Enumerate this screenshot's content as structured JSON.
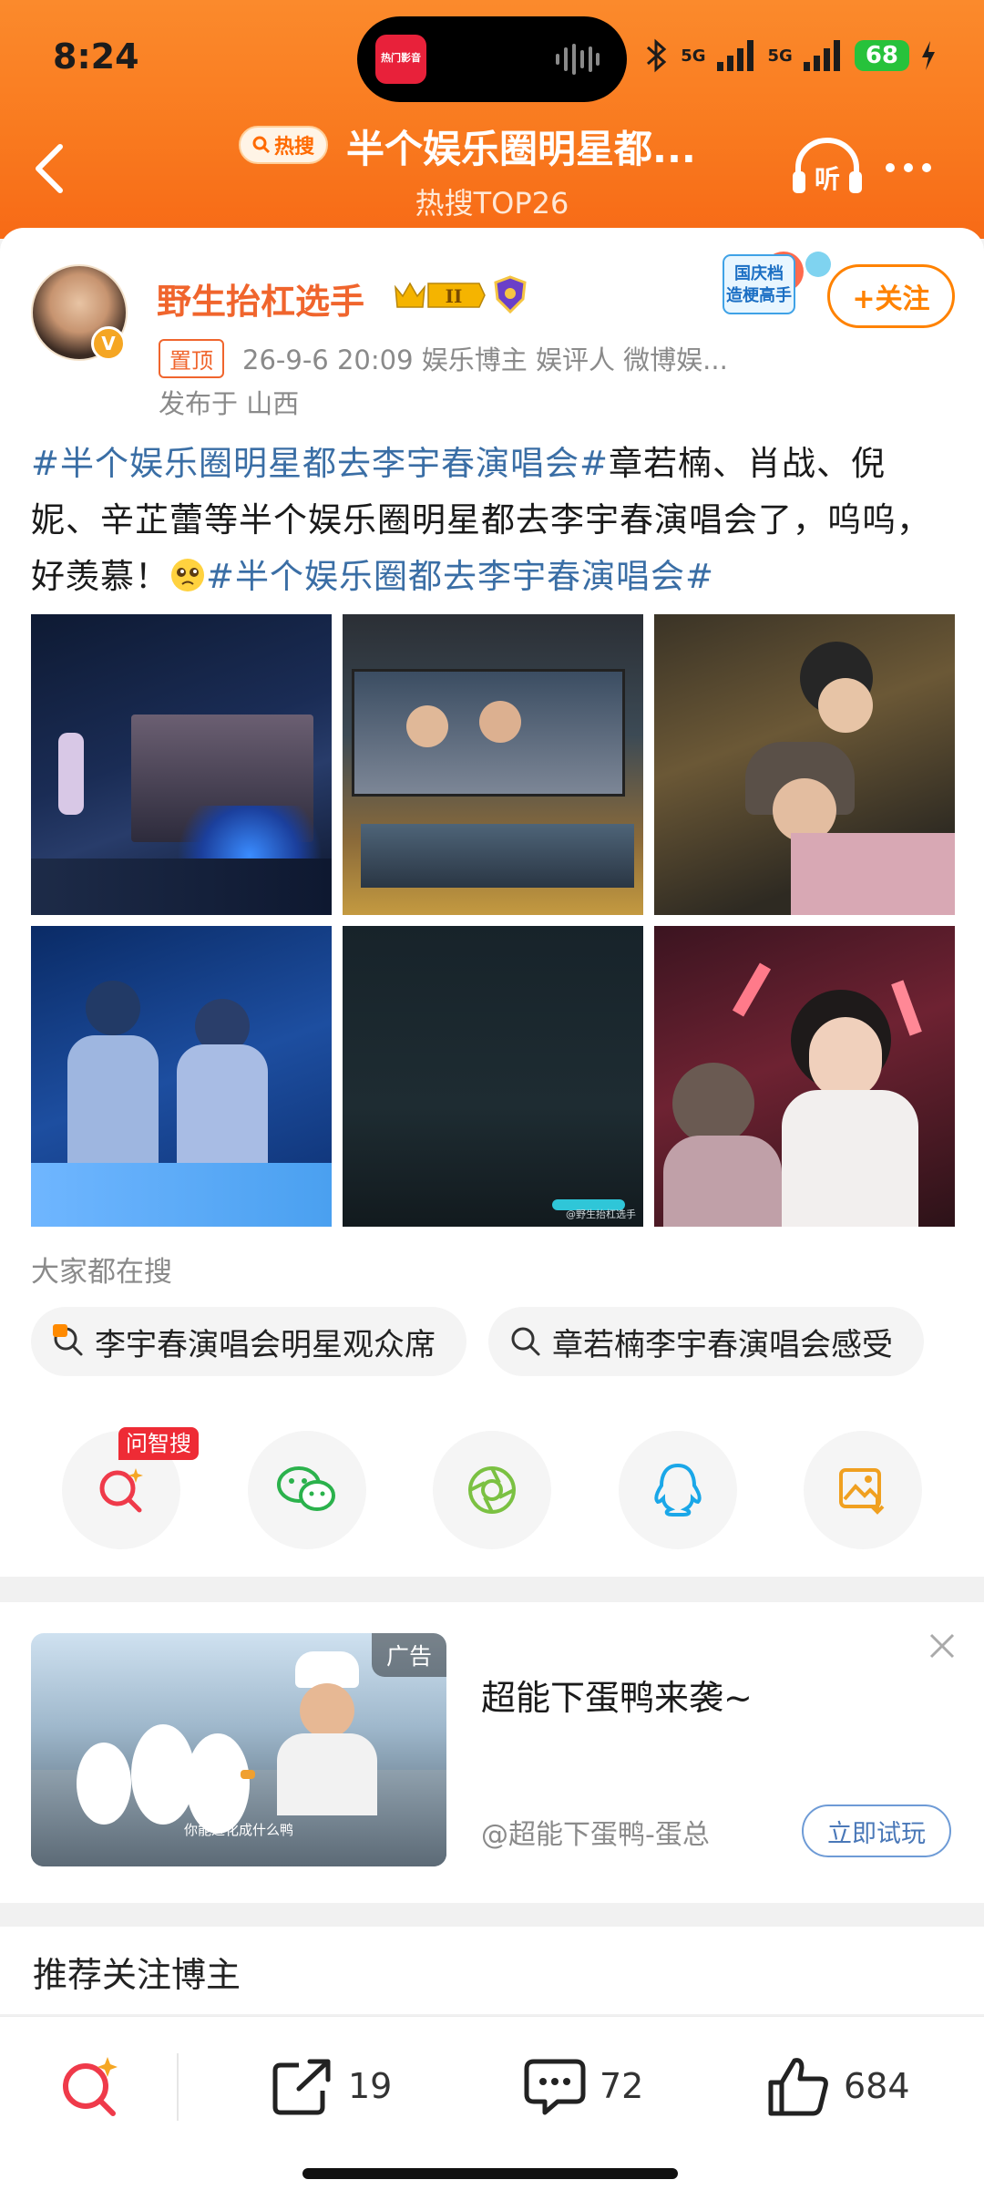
{
  "status_bar": {
    "time": "8:24",
    "island_app": "热门影音",
    "signal_1": "5G",
    "signal_2": "5G",
    "battery": "68"
  },
  "header": {
    "hot_tag": "热搜",
    "title": "半个娱乐圈明星都...",
    "subtitle": "热搜TOP26",
    "listen_label": "听"
  },
  "post": {
    "author": "野生抬杠选手",
    "level_badge": "II",
    "promo_text": "国庆档 造梗高手",
    "follow_label": "+关注",
    "pin_label": "置顶",
    "meta": "26-9-6 20:09  娱乐博主 娱评人 微博娱...",
    "location": "发布于 山西",
    "text_tag1": "#半个娱乐圈明星都去李宇春演唱会#",
    "text_body": "章若楠、肖战、倪妮、辛芷蕾等半个娱乐圈明星都去李宇春演唱会了，呜呜，好羡慕！",
    "text_tag2": "#半个娱乐圈都去李宇春演唱会#",
    "photo_watermark": "@野生抬杠选手"
  },
  "search_suggest": {
    "heading": "大家都在搜",
    "chips": [
      "李宇春演唱会明星观众席",
      "章若楠李宇春演唱会感受"
    ]
  },
  "share": {
    "ask_badge": "问智搜",
    "icons": [
      "ask-search-icon",
      "wechat-icon",
      "moments-icon",
      "qq-icon",
      "save-image-icon"
    ]
  },
  "ad": {
    "tag": "广告",
    "caption": "你能进化成什么鸭",
    "title": "超能下蛋鸭来袭~",
    "source": "@超能下蛋鸭-蛋总",
    "cta": "立即试玩"
  },
  "recommend": {
    "title": "推荐关注博主"
  },
  "bottom_bar": {
    "forward_count": "19",
    "comment_count": "72",
    "like_count": "684"
  },
  "colors": {
    "header_orange": "#f97a1f",
    "username_orange": "#f0652d",
    "hashtag_blue": "#3a6ea5",
    "follow_orange": "#ff8200"
  }
}
